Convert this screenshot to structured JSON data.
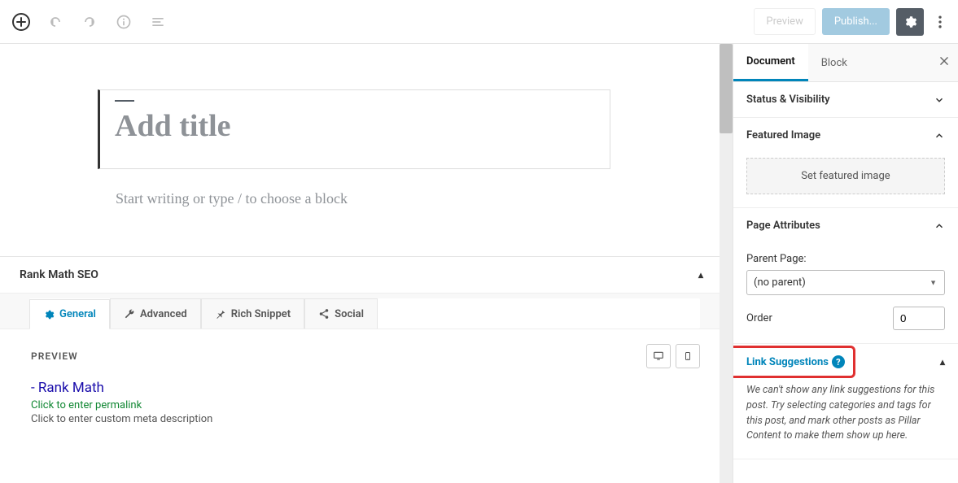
{
  "topbar": {
    "preview_label": "Preview",
    "publish_label": "Publish..."
  },
  "editor": {
    "title_placeholder": "Add title",
    "body_placeholder": "Start writing or type / to choose a block"
  },
  "seo": {
    "panel_title": "Rank Math SEO",
    "tabs": {
      "general": "General",
      "advanced": "Advanced",
      "rich_snippet": "Rich Snippet",
      "social": "Social"
    },
    "preview_label": "PREVIEW",
    "serp": {
      "title": "- Rank Math",
      "permalink": "Click to enter permalink",
      "description": "Click to enter custom meta description"
    }
  },
  "sidebar": {
    "tabs": {
      "document": "Document",
      "block": "Block"
    },
    "status_visibility": "Status & Visibility",
    "featured_image": {
      "title": "Featured Image",
      "button": "Set featured image"
    },
    "page_attributes": {
      "title": "Page Attributes",
      "parent_label": "Parent Page:",
      "parent_value": "(no parent)",
      "order_label": "Order",
      "order_value": "0"
    },
    "link_suggestions": {
      "title": "Link Suggestions",
      "message": "We can't show any link suggestions for this post. Try selecting categories and tags for this post, and mark other posts as Pillar Content to make them show up here."
    }
  }
}
